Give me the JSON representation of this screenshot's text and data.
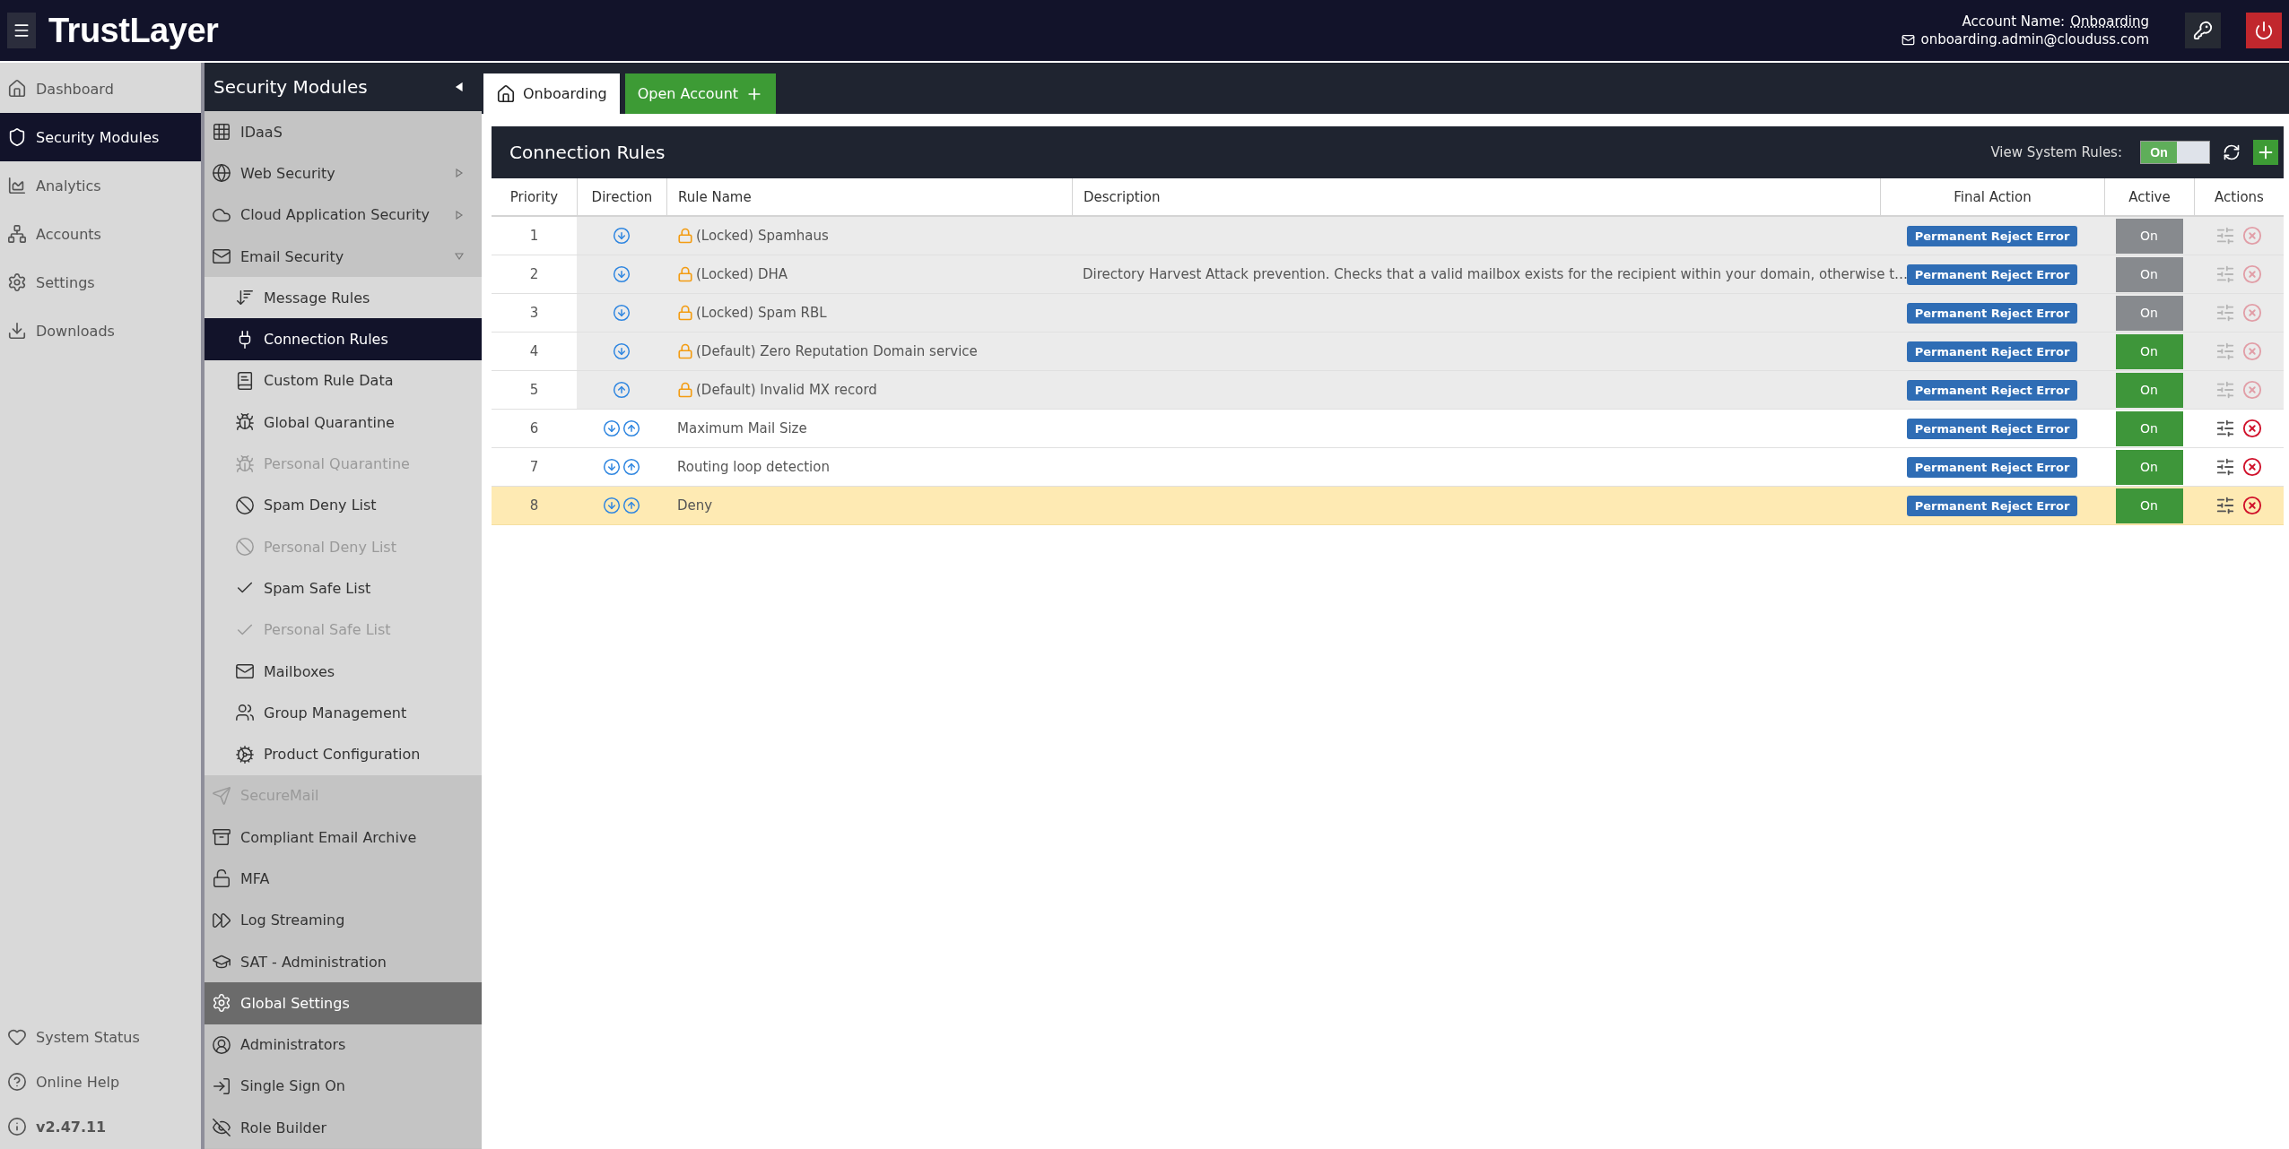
{
  "header": {
    "logo": "TrustLayer",
    "account_label": "Account Name:",
    "account_name": "Onboarding",
    "email": "onboarding.admin@clouduss.com"
  },
  "main_nav": {
    "items": [
      {
        "label": "Dashboard",
        "selected": false
      },
      {
        "label": "Security Modules",
        "selected": true
      },
      {
        "label": "Analytics",
        "selected": false
      },
      {
        "label": "Accounts",
        "selected": false
      },
      {
        "label": "Settings",
        "selected": false
      },
      {
        "label": "Downloads",
        "selected": false
      }
    ],
    "bottom_items": [
      {
        "label": "System Status"
      },
      {
        "label": "Online Help"
      }
    ],
    "version": "v2.47.11"
  },
  "modules": {
    "title": "Security Modules",
    "items": [
      {
        "label": "IDaaS",
        "kind": "section",
        "selected": false,
        "disabled": false
      },
      {
        "label": "Web Security",
        "kind": "section",
        "selected": false,
        "disabled": false,
        "expanded": false
      },
      {
        "label": "Cloud Application Security",
        "kind": "section",
        "selected": false,
        "disabled": false,
        "expanded": false
      },
      {
        "label": "Email Security",
        "kind": "section",
        "selected": false,
        "disabled": false,
        "expanded": true
      },
      {
        "label": "Message Rules",
        "kind": "sub",
        "selected": false,
        "disabled": false
      },
      {
        "label": "Connection Rules",
        "kind": "sub",
        "selected": true,
        "disabled": false
      },
      {
        "label": "Custom Rule Data",
        "kind": "sub",
        "selected": false,
        "disabled": false
      },
      {
        "label": "Global Quarantine",
        "kind": "sub",
        "selected": false,
        "disabled": false
      },
      {
        "label": "Personal Quarantine",
        "kind": "sub",
        "selected": false,
        "disabled": true
      },
      {
        "label": "Spam Deny List",
        "kind": "sub",
        "selected": false,
        "disabled": false
      },
      {
        "label": "Personal Deny List",
        "kind": "sub",
        "selected": false,
        "disabled": true
      },
      {
        "label": "Spam Safe List",
        "kind": "sub",
        "selected": false,
        "disabled": false
      },
      {
        "label": "Personal Safe List",
        "kind": "sub",
        "selected": false,
        "disabled": true
      },
      {
        "label": "Mailboxes",
        "kind": "sub",
        "selected": false,
        "disabled": false
      },
      {
        "label": "Group Management",
        "kind": "sub",
        "selected": false,
        "disabled": false
      },
      {
        "label": "Product Configuration",
        "kind": "sub",
        "selected": false,
        "disabled": false
      },
      {
        "label": "SecureMail",
        "kind": "section",
        "selected": false,
        "disabled": true
      },
      {
        "label": "Compliant Email Archive",
        "kind": "section",
        "selected": false,
        "disabled": false
      },
      {
        "label": "MFA",
        "kind": "section",
        "selected": false,
        "disabled": false
      },
      {
        "label": "Log Streaming",
        "kind": "section",
        "selected": false,
        "disabled": false
      },
      {
        "label": "SAT - Administration",
        "kind": "section",
        "selected": false,
        "disabled": false
      },
      {
        "label": "Global Settings",
        "kind": "section",
        "selected": true,
        "disabled": false
      },
      {
        "label": "Administrators",
        "kind": "section",
        "selected": false,
        "disabled": false
      },
      {
        "label": "Single Sign On",
        "kind": "section",
        "selected": false,
        "disabled": false
      },
      {
        "label": "Role Builder",
        "kind": "section",
        "selected": false,
        "disabled": false
      }
    ]
  },
  "tabs": [
    {
      "label": "Onboarding",
      "kind": "home",
      "selected": true
    },
    {
      "label": "Open Account",
      "kind": "add",
      "selected": false
    }
  ],
  "panel": {
    "title": "Connection Rules",
    "view_system_rules": "View System Rules:",
    "toggle": {
      "label": "On",
      "on": true
    }
  },
  "table": {
    "columns": [
      "Priority",
      "Direction",
      "Rule Name",
      "Description",
      "Final Action",
      "Active",
      "Actions"
    ],
    "rows": [
      {
        "priority": "1",
        "inbound": true,
        "outbound": false,
        "locked": true,
        "name": "(Locked) Spamhaus",
        "final_action": "Permanent Reject Error",
        "active": "On",
        "active_disabled": true,
        "system": true,
        "selected": false
      },
      {
        "priority": "2",
        "inbound": true,
        "outbound": false,
        "locked": true,
        "name": "(Locked) DHA",
        "description": "Directory Harvest Attack prevention. Checks that a valid mailbox exists for the recipient within your domain, otherwise t…",
        "final_action": "Permanent Reject Error",
        "active": "On",
        "active_disabled": true,
        "system": true,
        "selected": false
      },
      {
        "priority": "3",
        "inbound": true,
        "outbound": false,
        "locked": true,
        "name": "(Locked) Spam RBL",
        "final_action": "Permanent Reject Error",
        "active": "On",
        "active_disabled": true,
        "system": true,
        "selected": false
      },
      {
        "priority": "4",
        "inbound": true,
        "outbound": false,
        "locked": true,
        "name": "(Default) Zero Reputation Domain service",
        "final_action": "Permanent Reject Error",
        "active": "On",
        "active_disabled": false,
        "system": true,
        "selected": false
      },
      {
        "priority": "5",
        "inbound": false,
        "outbound": true,
        "locked": true,
        "name": "(Default) Invalid MX record",
        "final_action": "Permanent Reject Error",
        "active": "On",
        "active_disabled": false,
        "system": true,
        "selected": false
      },
      {
        "priority": "6",
        "inbound": true,
        "outbound": true,
        "locked": false,
        "name": "Maximum Mail Size",
        "final_action": "Permanent Reject Error",
        "active": "On",
        "active_disabled": false,
        "system": false,
        "selected": false
      },
      {
        "priority": "7",
        "inbound": true,
        "outbound": true,
        "locked": false,
        "name": "Routing loop detection",
        "final_action": "Permanent Reject Error",
        "active": "On",
        "active_disabled": false,
        "system": false,
        "selected": false
      },
      {
        "priority": "8",
        "inbound": true,
        "outbound": true,
        "locked": false,
        "name": "Deny",
        "final_action": "Permanent Reject Error",
        "active": "On",
        "active_disabled": false,
        "system": false,
        "selected": true
      }
    ]
  }
}
